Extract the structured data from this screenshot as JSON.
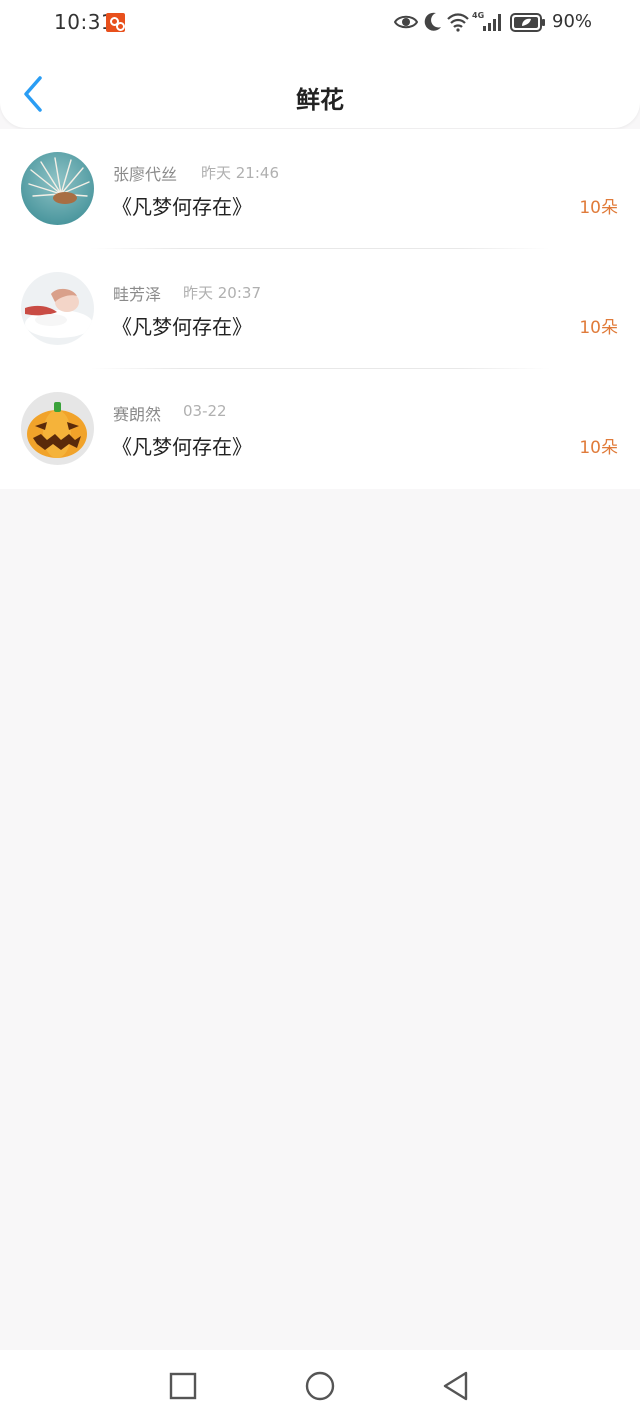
{
  "status_bar": {
    "time": "10:31",
    "network": "4G",
    "battery": "90%",
    "icons": [
      "app-badge-icon",
      "eye-icon",
      "moon-icon",
      "wifi-icon",
      "signal-icon",
      "battery-icon"
    ]
  },
  "header": {
    "back_icon": "chevron-left-icon",
    "title": "鲜花"
  },
  "list": [
    {
      "avatar": "feather-avatar",
      "user": "张廖代丝",
      "time": "昨天 21:46",
      "book": "《凡梦何存在》",
      "count": "10朵"
    },
    {
      "avatar": "girl-avatar",
      "user": "畦芳泽",
      "time": "昨天 20:37",
      "book": "《凡梦何存在》",
      "count": "10朵"
    },
    {
      "avatar": "pumpkin-avatar",
      "user": "赛朗然",
      "time": "03-22",
      "book": "《凡梦何存在》",
      "count": "10朵"
    }
  ],
  "bottom_nav": {
    "icons": [
      "square-icon",
      "circle-icon",
      "triangle-back-icon"
    ]
  },
  "colors": {
    "accent": "#2a9df4",
    "count": "#e07b3a",
    "background": "#f8f7f8"
  }
}
